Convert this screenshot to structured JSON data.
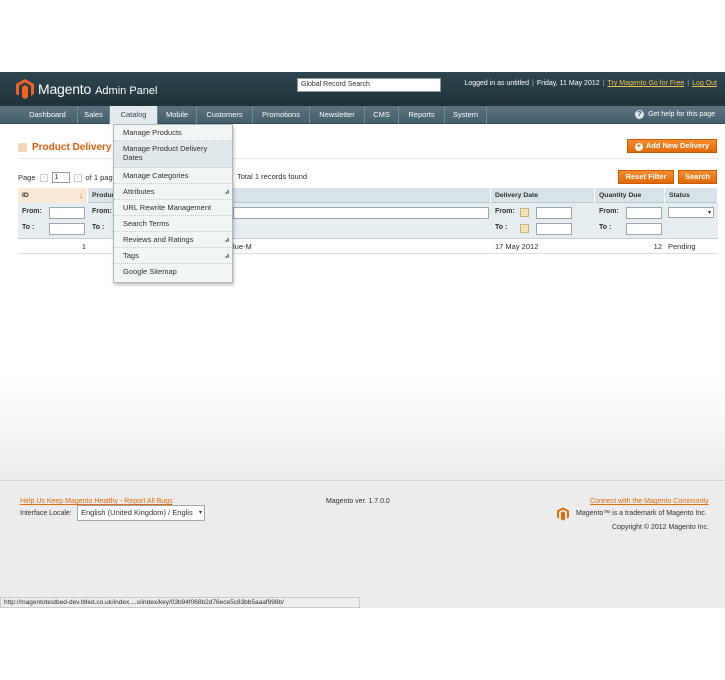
{
  "header": {
    "logo_text": "Magento",
    "logo_sub": "Admin Panel",
    "global_search": "Global Record Search",
    "logged_in": "Logged in as untitled",
    "date": "Friday, 11 May 2012",
    "try_link": "Try Magento Go for Free",
    "logout": "Log Out"
  },
  "nav": {
    "items": [
      "Dashboard",
      "Sales",
      "Catalog",
      "Mobile",
      "Customers",
      "Promotions",
      "Newsletter",
      "CMS",
      "Reports",
      "System"
    ],
    "help": "Get help for this page"
  },
  "catalog_menu": [
    "Manage Products",
    "Manage Product Delivery Dates",
    "Manage Categories",
    "Attributes",
    "URL Rewrite Management",
    "Search Terms",
    "Reviews and Ratings",
    "Tags",
    "Google Sitemap"
  ],
  "page": {
    "title": "Product Delivery D",
    "add_button": "Add New Delivery",
    "reset_button": "Reset Filter",
    "search_button": "Search",
    "pager_page": "Page",
    "pager_value": "1",
    "pager_of": "of 1 pages",
    "records": "Total 1 records found"
  },
  "grid": {
    "columns": [
      "ID",
      "Produc",
      "",
      "Delivery Date",
      "Quantity Due",
      "Status"
    ],
    "filter": {
      "from": "From:",
      "to": "To :"
    },
    "rows": [
      {
        "id": "1",
        "product": "lue-M",
        "delivery_date": "17 May 2012",
        "qty": "12",
        "status": "Pending"
      }
    ]
  },
  "footer": {
    "help_link": "Help Us Keep Magento Healthy - Report All Bugs",
    "version": "Magento ver. 1.7.0.0",
    "community_link": "Connect with the Magento Community",
    "trademark": "Magento™ is a trademark of Magento Inc.",
    "copyright": "Copyright © 2012 Magento Inc.",
    "locale_label": "Interface Locale:",
    "locale_value": "English (United Kingdom) / Englis"
  },
  "statusbar": "http://magentotestbed-dev.titled.co.uk/index....s/index/key/03b94f068b2d76ece5c83bb5aaaf998b/",
  "colors": {
    "accent": "#e26a08",
    "header_bg": "#2e4651",
    "nav_bg": "#4f6b77"
  }
}
